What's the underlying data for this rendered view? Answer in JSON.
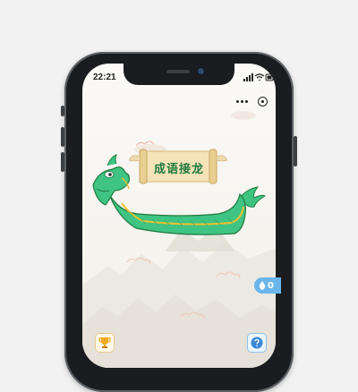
{
  "status_bar": {
    "time": "22:21",
    "icons": [
      "signal-icon",
      "wifi-icon",
      "battery-icon"
    ]
  },
  "capsule": {
    "icons": [
      "more-icon",
      "close-target-icon"
    ]
  },
  "banner": {
    "title": "成语接龙"
  },
  "badge": {
    "icon": "drop-icon",
    "value": "0"
  },
  "bottom": {
    "left_icon": "trophy-icon",
    "right_icon": "help-icon"
  },
  "colors": {
    "accent": "#1f7a3e",
    "dragon": "#3fc483",
    "badge": "#6ab6ea",
    "gold": "#f0c030"
  }
}
